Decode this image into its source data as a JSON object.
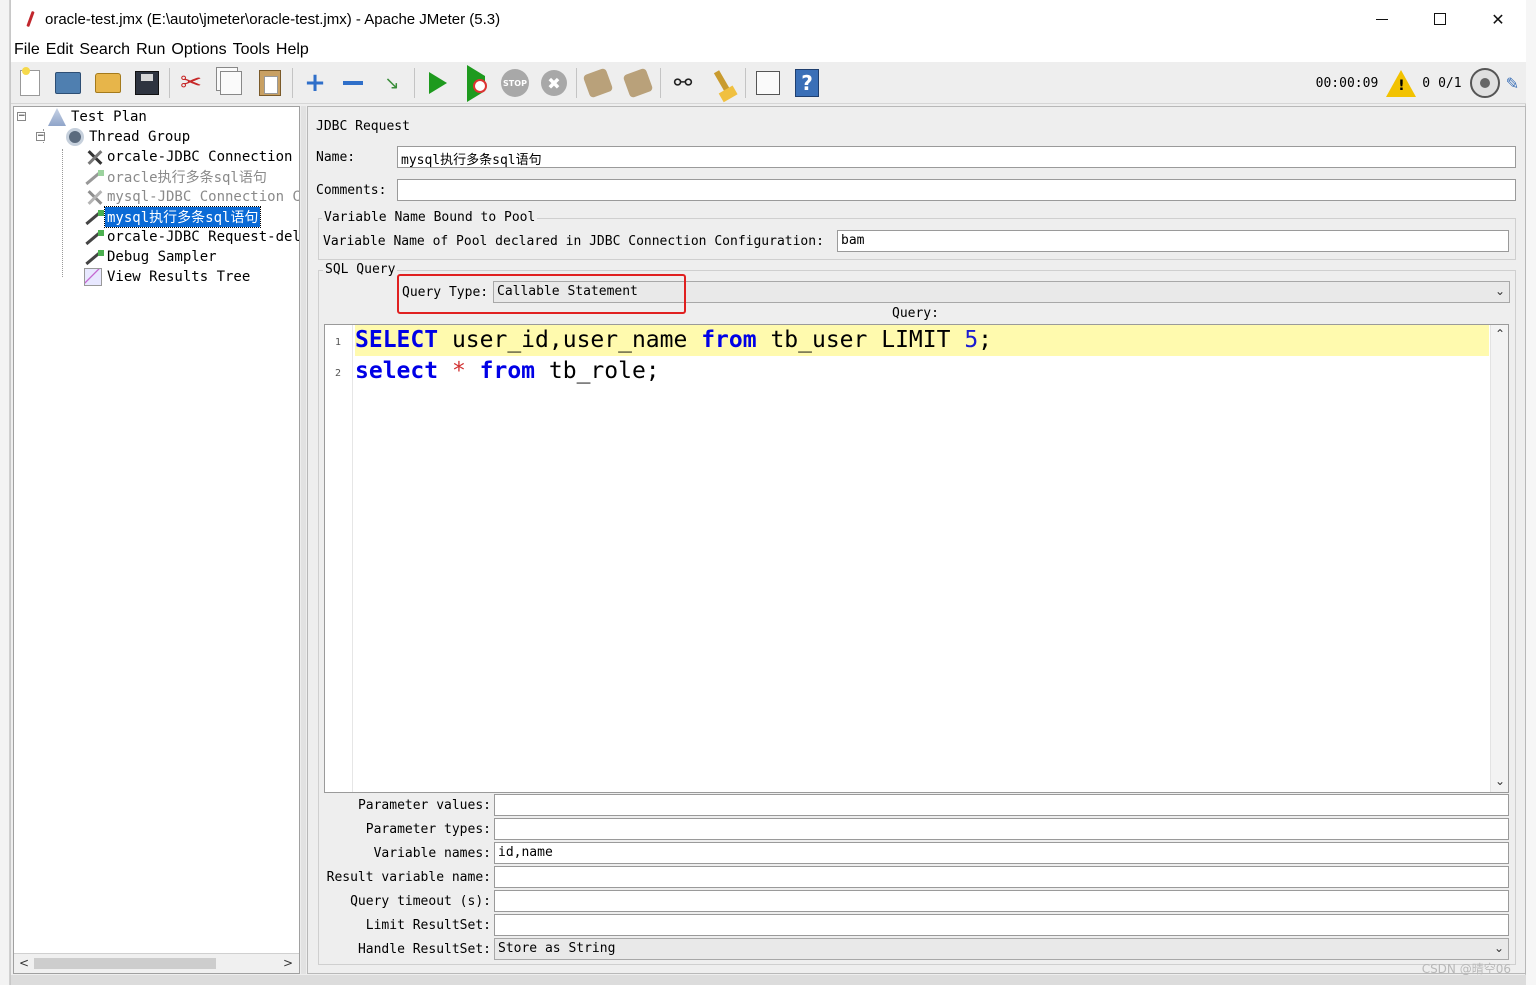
{
  "window": {
    "title": "oracle-test.jmx (E:\\auto\\jmeter\\oracle-test.jmx) - Apache JMeter (5.3)",
    "close_glyph": "✕"
  },
  "menu": [
    "File",
    "Edit",
    "Search",
    "Run",
    "Options",
    "Tools",
    "Help"
  ],
  "toolbar": {
    "icons": [
      "new-icon",
      "templates-icon",
      "open-icon",
      "save-icon",
      "cut-icon",
      "copy-icon",
      "paste-icon",
      "expand-icon",
      "collapse-icon",
      "toggle-icon",
      "start-icon",
      "start-no-pauses-icon",
      "stop-icon",
      "shutdown-icon",
      "clear-icon",
      "clear-all-icon",
      "search-icon",
      "reset-search-icon",
      "function-helper-icon",
      "help-icon"
    ],
    "stop_label": "STOP",
    "shutdown_glyph": "✖",
    "help_glyph": "?",
    "elapsed": "00:00:09",
    "warn_glyph": "!",
    "error_count": "0",
    "threads": "0/1"
  },
  "tree": {
    "items": [
      {
        "label": "Test Plan",
        "icon": "test-plan-icon",
        "disabled": false,
        "selected": false
      },
      {
        "label": "Thread Group",
        "icon": "thread-group-icon",
        "disabled": false,
        "selected": false
      },
      {
        "label": "orcale-JDBC Connection C",
        "icon": "config-element-icon",
        "disabled": false,
        "selected": false
      },
      {
        "label": "oracle执行多条sql语句",
        "icon": "sampler-icon",
        "disabled": true,
        "selected": false
      },
      {
        "label": "mysql-JDBC Connection Cor",
        "icon": "config-element-icon",
        "disabled": true,
        "selected": false
      },
      {
        "label": "mysql执行多条sql语句",
        "icon": "sampler-icon",
        "disabled": false,
        "selected": true
      },
      {
        "label": "orcale-JDBC Request-del",
        "icon": "sampler-icon",
        "disabled": false,
        "selected": false
      },
      {
        "label": "Debug Sampler",
        "icon": "sampler-icon",
        "disabled": false,
        "selected": false
      },
      {
        "label": "View Results Tree",
        "icon": "listener-icon",
        "disabled": false,
        "selected": false
      }
    ]
  },
  "panel": {
    "heading": "JDBC Request",
    "name_label": "Name:",
    "name_value": "mysql执行多条sql语句",
    "comments_label": "Comments:",
    "comments_value": "",
    "pool_group_title": "Variable Name Bound to Pool",
    "pool_label": "Variable Name of Pool declared in JDBC Connection Configuration:",
    "pool_value": "bam",
    "sql_group_title": "SQL Query",
    "query_type_label": "Query Type:",
    "query_type_value": "Callable Statement",
    "query_label": "Query:",
    "code_lines": [
      {
        "num": "1"
      },
      {
        "num": "2"
      }
    ],
    "code": {
      "l1_kw1": "SELECT",
      "l1_mid": " user_id,user_name ",
      "l1_kw2": "from",
      "l1_tail": " tb_user LIMIT ",
      "l1_num": "5",
      "l1_end": ";",
      "l2_kw1": "select",
      "l2_op": " * ",
      "l2_kw2": "from",
      "l2_end": " tb_role;"
    },
    "params": [
      {
        "label": "Parameter values:",
        "value": ""
      },
      {
        "label": "Parameter types:",
        "value": ""
      },
      {
        "label": "Variable names:",
        "value": "id,name"
      },
      {
        "label": "Result variable name:",
        "value": ""
      },
      {
        "label": "Query timeout (s):",
        "value": ""
      },
      {
        "label": "Limit ResultSet:",
        "value": ""
      }
    ],
    "handle_resultset_label": "Handle ResultSet:",
    "handle_resultset_value": "Store as String"
  },
  "watermark": "CSDN @晴空06",
  "colors": {
    "selection": "#0a6ad6",
    "highlight_box": "#e02020",
    "keyword": "#0000e6",
    "current_line": "#fffaae"
  }
}
